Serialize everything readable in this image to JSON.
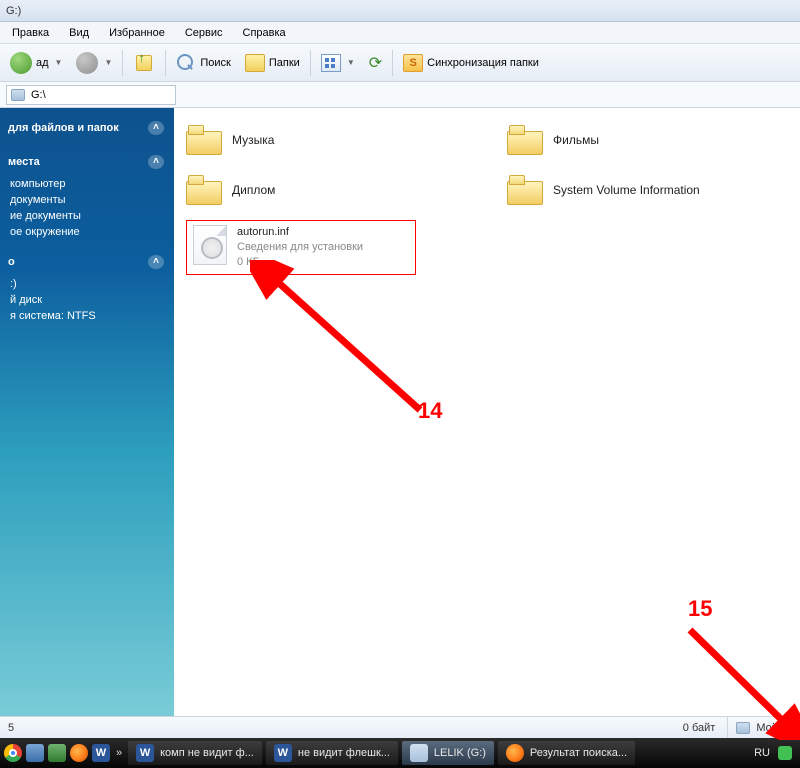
{
  "title_suffix": "G:)",
  "menubar": [
    "Правка",
    "Вид",
    "Избранное",
    "Сервис",
    "Справка"
  ],
  "toolbar": {
    "back_label": "ад",
    "search_label": "Поиск",
    "folders_label": "Папки",
    "sync_label": "Синхронизация папки"
  },
  "address": {
    "path": "G:\\"
  },
  "sidebar": {
    "tasks_title": "для файлов и папок",
    "places_title": "места",
    "places": [
      "компьютер",
      "документы",
      "ие документы",
      "ое окружение"
    ],
    "details_title": "о",
    "details": [
      ":)",
      "й диск",
      "я система: NTFS"
    ]
  },
  "content": {
    "folders": [
      {
        "label": "Музыка"
      },
      {
        "label": "Фильмы"
      },
      {
        "label": "Диплом"
      },
      {
        "label": "System Volume Information"
      }
    ],
    "file": {
      "name": "autorun.inf",
      "type": "Сведения для установки",
      "size": "0 КБ"
    }
  },
  "status": {
    "left": "5",
    "bytes": "0 байт",
    "location": "Мой ко"
  },
  "taskbar": {
    "items": [
      {
        "app": "word",
        "label": "комп не видит ф..."
      },
      {
        "app": "word",
        "label": "не видит флешк..."
      },
      {
        "app": "explorer",
        "label": "LELIK (G:)"
      },
      {
        "app": "firefox",
        "label": "Результат поиска..."
      }
    ],
    "lang": "RU",
    "chevron": "»"
  },
  "annotations": {
    "a14": "14",
    "a15": "15"
  }
}
